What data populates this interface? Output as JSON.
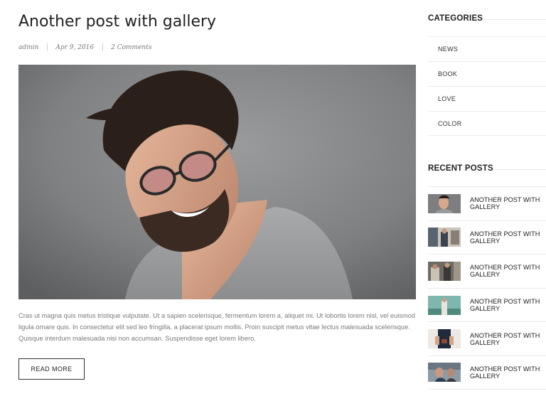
{
  "post": {
    "title": "Another post with gallery",
    "author": "admin",
    "date": "Apr 9, 2016",
    "comments": "2 Comments",
    "excerpt": "Cras ut magna quis metus tristique vulputate. Ut a sapien scelerisque, fermentum lorem a, aliquet mi. Ut lobortis lorem nisl, vel euismod ligula ornare quis. In consectetur elit sed leo fringilla, a placerat ipsum mollis. Proin suscipit metus vitae lectus malesuada scelerisque. Quisque interdum malesuada nisi non accumsan. Suspendisse eget lorem libero.",
    "read_more_label": "READ MORE"
  },
  "sidebar": {
    "categories_title": "CATEGORIES",
    "categories": [
      {
        "label": "NEWS"
      },
      {
        "label": "BOOK"
      },
      {
        "label": "LOVE"
      },
      {
        "label": "COLOR"
      }
    ],
    "recent_title": "RECENT POSTS",
    "recent_posts": [
      {
        "label": "ANOTHER POST WITH GALLERY"
      },
      {
        "label": "ANOTHER POST WITH GALLERY"
      },
      {
        "label": "ANOTHER POST WITH GALLERY"
      },
      {
        "label": "ANOTHER POST WITH GALLERY"
      },
      {
        "label": "ANOTHER POST WITH GALLERY"
      },
      {
        "label": "ANOTHER POST WITH GALLERY"
      }
    ]
  },
  "colors": {
    "text": "#222222",
    "muted": "#7a7a7a",
    "rule": "#ebebeb"
  }
}
